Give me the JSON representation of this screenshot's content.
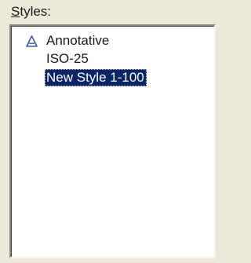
{
  "group": {
    "label_mnemonic": "S",
    "label_rest": "tyles:"
  },
  "styles_list": {
    "items": [
      {
        "label": "Annotative",
        "icon": "annotative-icon",
        "selected": false
      },
      {
        "label": "ISO-25",
        "icon": "",
        "selected": false
      },
      {
        "label": "New Style 1-100",
        "icon": "",
        "selected": true
      }
    ]
  },
  "colors": {
    "selection_bg": "#0a246a",
    "selection_fg": "#ffffff",
    "panel_bg": "#ece9d8",
    "icon_color": "#3a5aa8"
  }
}
